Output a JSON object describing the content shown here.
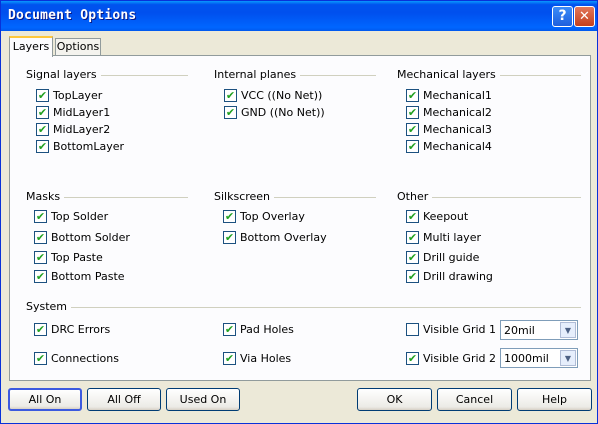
{
  "window": {
    "title": "Document Options",
    "help_glyph": "?",
    "close_glyph": "✕"
  },
  "tabs": [
    {
      "label": "Layers"
    },
    {
      "label": "Options"
    }
  ],
  "check_glyph": "✔",
  "groups": {
    "signal": {
      "title": "Signal layers",
      "items": [
        {
          "label": "TopLayer",
          "checked": true
        },
        {
          "label": "MidLayer1",
          "checked": true
        },
        {
          "label": "MidLayer2",
          "checked": true
        },
        {
          "label": "BottomLayer",
          "checked": true
        }
      ]
    },
    "internal": {
      "title": "Internal planes",
      "items": [
        {
          "label": "VCC ((No Net))",
          "checked": true
        },
        {
          "label": "GND ((No Net))",
          "checked": true
        }
      ]
    },
    "mechanical": {
      "title": "Mechanical layers",
      "items": [
        {
          "label": "Mechanical1",
          "checked": true
        },
        {
          "label": "Mechanical2",
          "checked": true
        },
        {
          "label": "Mechanical3",
          "checked": true
        },
        {
          "label": "Mechanical4",
          "checked": true
        }
      ]
    },
    "masks": {
      "title": "Masks",
      "items": [
        {
          "label": "Top Solder",
          "checked": true
        },
        {
          "label": "Bottom Solder",
          "checked": true
        },
        {
          "label": "Top Paste",
          "checked": true
        },
        {
          "label": "Bottom Paste",
          "checked": true
        }
      ]
    },
    "silkscreen": {
      "title": "Silkscreen",
      "items": [
        {
          "label": "Top Overlay",
          "checked": true
        },
        {
          "label": "Bottom Overlay",
          "checked": true
        }
      ]
    },
    "other": {
      "title": "Other",
      "items": [
        {
          "label": "Keepout",
          "checked": true
        },
        {
          "label": "Multi layer",
          "checked": true
        },
        {
          "label": "Drill guide",
          "checked": true
        },
        {
          "label": "Drill drawing",
          "checked": true
        }
      ]
    },
    "system": {
      "title": "System",
      "items": [
        {
          "label": "DRC Errors",
          "checked": true
        },
        {
          "label": "Connections",
          "checked": true
        },
        {
          "label": "Pad Holes",
          "checked": true
        },
        {
          "label": "Via Holes",
          "checked": true
        },
        {
          "label": "Visible Grid 1",
          "checked": false
        },
        {
          "label": "Visible Grid 2",
          "checked": true
        }
      ],
      "grid1_value": "20mil",
      "grid2_value": "1000mil"
    }
  },
  "buttons": {
    "all_on": "All On",
    "all_off": "All Off",
    "used_on": "Used On",
    "ok": "OK",
    "cancel": "Cancel",
    "help": "Help"
  }
}
